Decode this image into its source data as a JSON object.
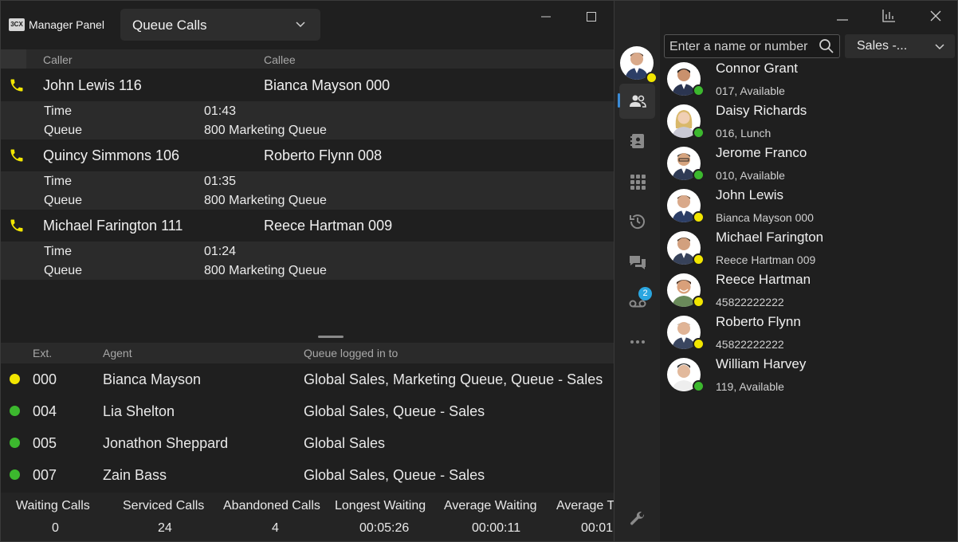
{
  "manager": {
    "logo": "3CX",
    "title": "Manager Panel",
    "view_selector": "Queue Calls",
    "calls_header": {
      "caller": "Caller",
      "callee": "Callee"
    },
    "calls": [
      {
        "caller": "John Lewis 116",
        "callee": "Bianca Mayson 000",
        "time_label": "Time",
        "time": "01:43",
        "queue_label": "Queue",
        "queue": "800 Marketing Queue"
      },
      {
        "caller": "Quincy Simmons 106",
        "callee": "Roberto Flynn 008",
        "time_label": "Time",
        "time": "01:35",
        "queue_label": "Queue",
        "queue": "800 Marketing Queue"
      },
      {
        "caller": "Michael Farington 111",
        "callee": "Reece Hartman 009",
        "time_label": "Time",
        "time": "01:24",
        "queue_label": "Queue",
        "queue": "800 Marketing Queue"
      }
    ],
    "agents_header": {
      "ext": "Ext.",
      "agent": "Agent",
      "queue": "Queue logged in to"
    },
    "agents": [
      {
        "ext": "000",
        "name": "Bianca Mayson",
        "queues": "Global Sales, Marketing Queue, Queue - Sales",
        "status_color": "#f2e600"
      },
      {
        "ext": "004",
        "name": "Lia Shelton",
        "queues": "Global Sales, Queue - Sales",
        "status_color": "#3cb82e"
      },
      {
        "ext": "005",
        "name": "Jonathon Sheppard",
        "queues": "Global Sales",
        "status_color": "#3cb82e"
      },
      {
        "ext": "007",
        "name": "Zain Bass",
        "queues": "Global Sales, Queue - Sales",
        "status_color": "#3cb82e"
      }
    ],
    "stats": [
      {
        "label": "Waiting Calls",
        "value": "0"
      },
      {
        "label": "Serviced Calls",
        "value": "24"
      },
      {
        "label": "Abandoned Calls",
        "value": "4"
      },
      {
        "label": "Longest Waiting",
        "value": "00:05:26"
      },
      {
        "label": "Average Waiting",
        "value": "00:00:11"
      },
      {
        "label": "Average T",
        "value": "00:01:"
      }
    ]
  },
  "client": {
    "search_placeholder": "Enter a name or number",
    "group_selector": "Sales -...",
    "voicemail_count": "2",
    "contacts": [
      {
        "name": "Connor Grant",
        "status": "017, Available",
        "presence": "#3cb82e"
      },
      {
        "name": "Daisy Richards",
        "status": "016, Lunch",
        "presence": "#3cb82e"
      },
      {
        "name": "Jerome Franco",
        "status": "010, Available",
        "presence": "#3cb82e"
      },
      {
        "name": "John Lewis",
        "status": "Bianca Mayson 000",
        "presence": "#f2e600"
      },
      {
        "name": "Michael Farington",
        "status": "Reece Hartman 009",
        "presence": "#f2e600"
      },
      {
        "name": "Reece Hartman",
        "status": "45822222222",
        "presence": "#f2e600"
      },
      {
        "name": "Roberto Flynn",
        "status": "45822222222",
        "presence": "#f2e600"
      },
      {
        "name": "William Harvey",
        "status": "119, Available",
        "presence": "#3cb82e"
      }
    ]
  }
}
